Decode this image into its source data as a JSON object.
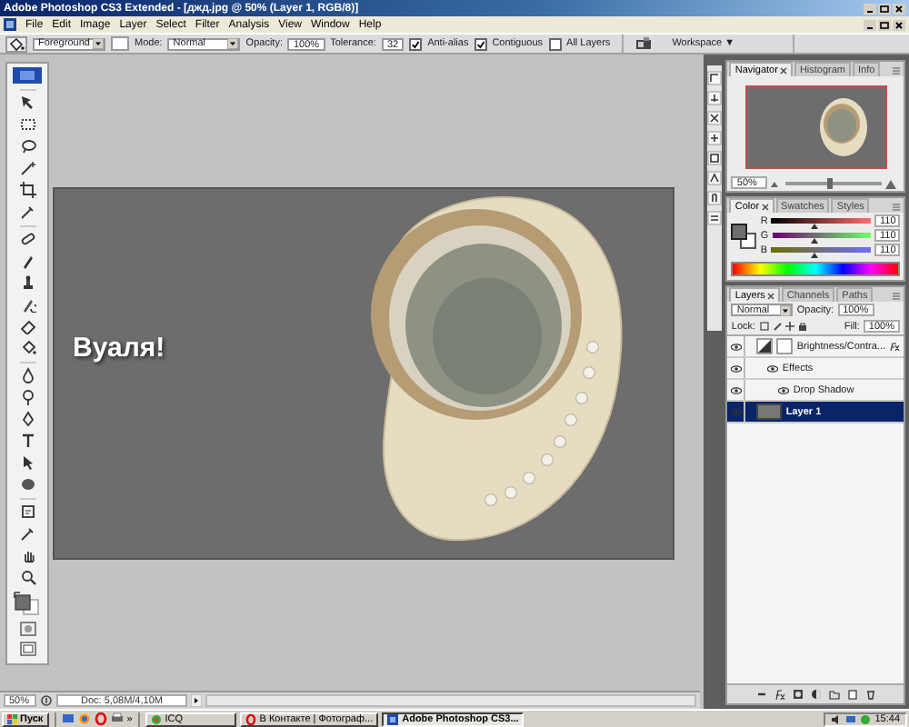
{
  "window": {
    "title": "Adobe Photoshop CS3 Extended - [джд.jpg @ 50% (Layer 1, RGB/8)]"
  },
  "menu": [
    "File",
    "Edit",
    "Image",
    "Layer",
    "Select",
    "Filter",
    "Analysis",
    "View",
    "Window",
    "Help"
  ],
  "options": {
    "preset": "Foreground",
    "mode_label": "Mode:",
    "mode": "Normal",
    "opacity_label": "Opacity:",
    "opacity": "100%",
    "tolerance_label": "Tolerance:",
    "tolerance": "32",
    "checks": [
      {
        "label": "Anti-alias",
        "checked": true
      },
      {
        "label": "Contiguous",
        "checked": true
      },
      {
        "label": "All Layers",
        "checked": false
      }
    ],
    "workspace": "Workspace ▼"
  },
  "document": {
    "caption": "Вуаля!"
  },
  "status": {
    "zoom": "50%",
    "doc": "Doc: 5,08M/4,10M"
  },
  "navigator": {
    "tabs": [
      {
        "label": "Navigator",
        "selected": true
      },
      {
        "label": "Histogram",
        "selected": false
      },
      {
        "label": "Info",
        "selected": false
      }
    ],
    "zoom": "50%",
    "level": 0.45
  },
  "color": {
    "tabs": [
      {
        "label": "Color",
        "selected": true
      },
      {
        "label": "Swatches",
        "selected": false
      },
      {
        "label": "Styles",
        "selected": false
      }
    ],
    "sliders": [
      {
        "label": "R",
        "value": "110",
        "level": 0.43
      },
      {
        "label": "G",
        "value": "110",
        "level": 0.43
      },
      {
        "label": "B",
        "value": "110",
        "level": 0.43
      }
    ]
  },
  "layers": {
    "tabs": [
      {
        "label": "Layers",
        "selected": true
      },
      {
        "label": "Channels",
        "selected": false
      },
      {
        "label": "Paths",
        "selected": false
      }
    ],
    "blend": "Normal",
    "opacity_label": "Opacity:",
    "opacity": "100%",
    "lock_label": "Lock:",
    "fill_label": "Fill:",
    "fill": "100%",
    "items": [
      {
        "name": "Brightness/Contra...",
        "kind": "adjustment",
        "visible": true,
        "selected": false,
        "children": [
          {
            "name": "Effects",
            "kind": "effects",
            "visible": true,
            "selected": false,
            "children": [
              {
                "name": "Drop Shadow",
                "kind": "effect",
                "visible": true,
                "selected": false
              }
            ]
          }
        ]
      },
      {
        "name": "Layer 1",
        "kind": "layer",
        "visible": true,
        "selected": true
      }
    ]
  },
  "taskbar": {
    "start": "Пуск",
    "more": "»",
    "tasks": [
      {
        "label": "ICQ",
        "selected": false
      },
      {
        "label": "В Контакте | Фотограф...",
        "selected": false
      },
      {
        "label": "Adobe Photoshop CS3...",
        "selected": true
      }
    ],
    "clock": "15:44"
  }
}
